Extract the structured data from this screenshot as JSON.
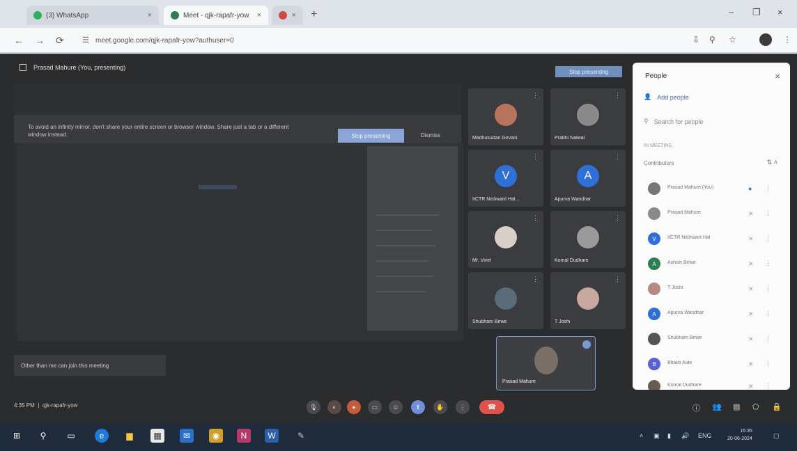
{
  "browser": {
    "tabs": [
      {
        "label": "(3) WhatsApp",
        "close": "×"
      },
      {
        "label": "Meet - qjk-rapafr-yow",
        "close": "×"
      },
      {
        "label": "",
        "close": "×"
      }
    ],
    "new_tab": "+",
    "window_controls": [
      "–",
      "❐",
      "×"
    ],
    "nav": [
      "←",
      "→",
      "⟳"
    ],
    "url": "meet.google.com/qjk-rapafr-yow?authuser=0"
  },
  "meet": {
    "presenting_label": "Prasad Mahure (You, presenting)",
    "stop_presenting": "Stop presenting",
    "warning_text": "To avoid an infinity mirror, don't share your entire screen or browser window. Share just a tab or a different window instead.",
    "stop_sharing": "Stop presenting",
    "dismiss": "Dismiss",
    "toast": "Other than me can join this meeting",
    "meeting_time": "4:35 PM",
    "meeting_code": "qjk-rapafr-yow",
    "participants": [
      {
        "name": "Madhusudan Girvani",
        "type": "photo",
        "color": "#b7735d"
      },
      {
        "name": "Prabhi Nalwal",
        "type": "photo",
        "color": "#8a8a8a"
      },
      {
        "name": "IICTR Nishwant Hal...",
        "type": "letter",
        "letter": "V",
        "color": "#2f6fd8"
      },
      {
        "name": "Apurva Wandhar",
        "type": "letter",
        "letter": "A",
        "color": "#2f6fd8"
      },
      {
        "name": "Mr. Vivel",
        "type": "photo",
        "color": "#d8cfc8"
      },
      {
        "name": "Komal Dudhare",
        "type": "photo",
        "color": "#9a9a9a"
      },
      {
        "name": "Shubham Birwe",
        "type": "photo",
        "color": "#5a6b7a"
      },
      {
        "name": "T Joshi",
        "type": "photo",
        "color": "#c9a8a0"
      }
    ],
    "self_name": "Prasad Mahure"
  },
  "people_panel": {
    "title": "People",
    "close": "×",
    "add_people": "Add people",
    "search_placeholder": "Search for people",
    "in_meeting": "IN MEETING",
    "contributors": "Contributors",
    "rows": [
      {
        "name": "Prasad Mahure (You)",
        "color": "#777777",
        "letter": ""
      },
      {
        "name": "Prasad Mahure",
        "color": "#8a8a8a",
        "letter": ""
      },
      {
        "name": "IICTR Nishwant Hal",
        "color": "#2f6fd8",
        "letter": "V"
      },
      {
        "name": "Ashish Birwe",
        "color": "#2e7d55",
        "letter": "A"
      },
      {
        "name": "T Joshi",
        "color": "#b58a80",
        "letter": ""
      },
      {
        "name": "Apurva Wandhar",
        "color": "#2f6fd8",
        "letter": "A"
      },
      {
        "name": "Shubham Birwe",
        "color": "#555555",
        "letter": ""
      },
      {
        "name": "Bhakti Aute",
        "color": "#5a60d8",
        "letter": "B"
      },
      {
        "name": "Komal Dudhare",
        "color": "#6a5a50",
        "letter": ""
      }
    ]
  },
  "taskbar": {
    "time": "16:35",
    "date": "20-06-2024"
  }
}
